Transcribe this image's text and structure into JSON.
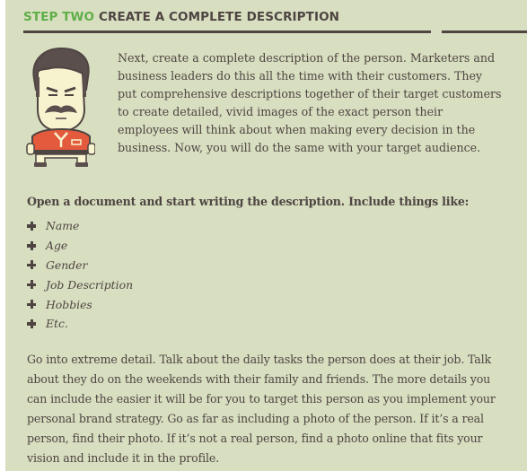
{
  "section": {
    "step_label": "STEP TWO",
    "title": "CREATE A COMPLETE DESCRIPTION",
    "accent_color": "#5fae48",
    "text_color": "#4e4542",
    "background_color": "#d8dec0"
  },
  "illustration": {
    "icon": "mustached-man-avatar-icon",
    "description": "Cartoon of a mustached man in a red polo shirt"
  },
  "intro_paragraph": "Next, create a complete description of the person. Marketers and business leaders do this all the time with their customers. They put comprehensive descriptions together of their target customers to create detailed, vivid images of the exact person their employees will think about when making every decision in the business. Now, you will do the same with your target audience.",
  "list_lead": "Open a document and start writing the description. Include things like:",
  "list_items": [
    {
      "icon": "plus-icon",
      "label": "Name"
    },
    {
      "icon": "plus-icon",
      "label": "Age"
    },
    {
      "icon": "plus-icon",
      "label": "Gender"
    },
    {
      "icon": "plus-icon",
      "label": "Job Description"
    },
    {
      "icon": "plus-icon",
      "label": "Hobbies"
    },
    {
      "icon": "plus-icon",
      "label": "Etc."
    }
  ],
  "outro_paragraph": "Go into extreme detail. Talk about the daily tasks the person does at their job. Talk about they do on the weekends with their family and friends. The more details you can include the easier it will be for you to target this person as you implement your personal brand strategy. Go as far as including a photo of the person. If it’s a real person, find their photo. If it’s not a real person, find a photo online that fits your vision and include it in the profile."
}
